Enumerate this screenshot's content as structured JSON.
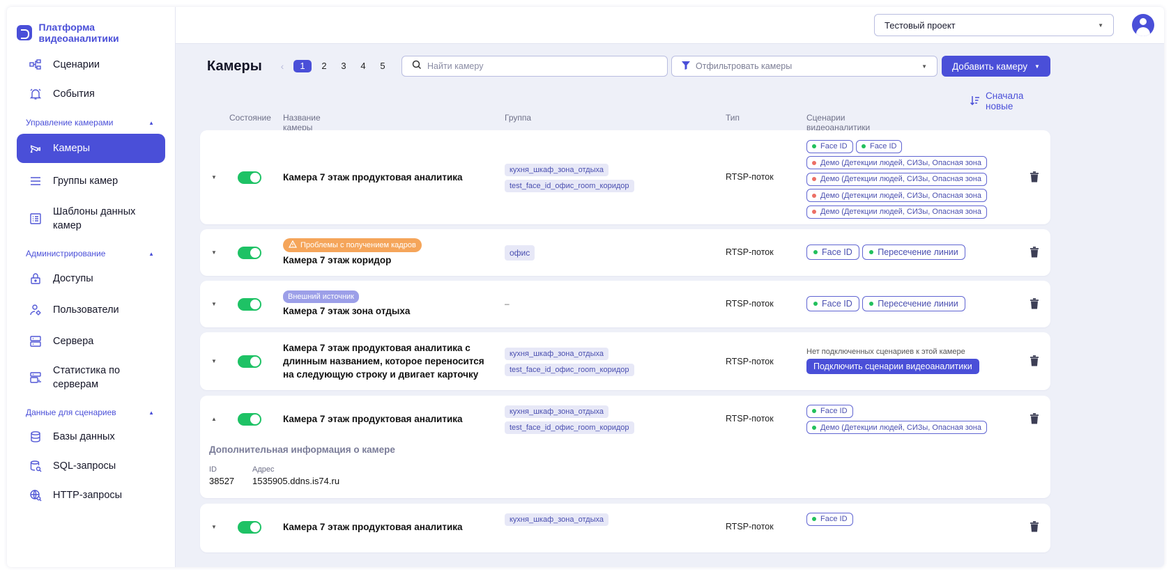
{
  "brand": {
    "title": "Платформа видеоаналитики"
  },
  "sidebar": {
    "items_top": [
      {
        "label": "Сценарии",
        "icon": "scenarios-icon"
      },
      {
        "label": "События",
        "icon": "bell-icon"
      }
    ],
    "section_cameras": "Управление камерами",
    "items_cameras": [
      {
        "label": "Камеры",
        "icon": "camera-icon",
        "active": true
      },
      {
        "label": "Группы камер",
        "icon": "list-icon"
      },
      {
        "label": "Шаблоны данных камер",
        "icon": "template-icon"
      }
    ],
    "section_admin": "Администрирование",
    "items_admin": [
      {
        "label": "Доступы",
        "icon": "lock-icon"
      },
      {
        "label": "Пользователи",
        "icon": "users-icon"
      },
      {
        "label": "Сервера",
        "icon": "server-icon"
      },
      {
        "label": "Статистика по серверам",
        "icon": "stats-icon"
      }
    ],
    "section_data": "Данные для сценариев",
    "items_data": [
      {
        "label": "Базы данных",
        "icon": "database-icon"
      },
      {
        "label": "SQL-запросы",
        "icon": "sql-icon"
      },
      {
        "label": "HTTP-запросы",
        "icon": "http-icon"
      }
    ]
  },
  "header": {
    "project": "Тестовый проект"
  },
  "toolbar": {
    "title": "Камеры",
    "pages": [
      "1",
      "2",
      "3",
      "4",
      "5"
    ],
    "current_page": "1",
    "search_placeholder": "Найти камеру",
    "filter_placeholder": "Отфильтровать камеры",
    "add_button": "Добавить камеру",
    "sort": "Сначала новые"
  },
  "columns": {
    "state": "Состояние",
    "name": "Название камеры",
    "group": "Группа",
    "type": "Тип",
    "scenarios": "Сценарии видеоаналитики"
  },
  "cameras": [
    {
      "name": "Камера 7 этаж продуктовая аналитика",
      "groups": [
        "кухня_шкаф_зона_отдыха",
        "test_face_id_офис_room_коридор"
      ],
      "type": "RTSP-поток",
      "scenarios": [
        "Face ID",
        "Face ID",
        "Демо (Детекции людей, СИЗы, Опасная зона",
        "Демо (Детекции людей, СИЗы, Опасная зона",
        "Демо (Детекции людей, СИЗы, Опасная зона",
        "Демо (Детекции людей, СИЗы, Опасная зона"
      ]
    },
    {
      "badge": "Проблемы с получением кадров",
      "name": "Камера 7 этаж коридор",
      "groups": [
        "офис"
      ],
      "type": "RTSP-поток",
      "scenarios": [
        "Face ID",
        "Пересечение линии"
      ]
    },
    {
      "badge": "Внешний источник",
      "name": "Камера 7 этаж зона отдыха",
      "group_empty": "–",
      "type": "RTSP-поток",
      "scenarios": [
        "Face ID",
        "Пересечение линии"
      ]
    },
    {
      "name": "Камера 7 этаж продуктовая аналитика с длинным названием, которое переносится на следующую строку и двигает карточку",
      "groups": [
        "кухня_шкаф_зона_отдыха",
        "test_face_id_офис_room_коридор"
      ],
      "type": "RTSP-поток",
      "no_scenarios": "Нет подключенных сценариев к этой камере",
      "connect_button": "Подключить сценарии видеоаналитики"
    },
    {
      "name": "Камера 7 этаж продуктовая аналитика",
      "groups": [
        "кухня_шкаф_зона_отдыха",
        "test_face_id_офис_room_коридор"
      ],
      "type": "RTSP-поток",
      "scenarios": [
        "Face ID",
        "Демо (Детекции людей, СИЗы, Опасная зона"
      ],
      "details": {
        "title": "Дополнительная информация о камере",
        "id_label": "ID",
        "id": "38527",
        "address_label": "Адрес",
        "address": "1535905.ddns.is74.ru"
      }
    },
    {
      "name": "Камера 7 этаж продуктовая аналитика",
      "groups": [
        "кухня_шкаф_зона_отдыха"
      ],
      "type": "RTSP-поток",
      "scenarios": [
        "Face ID"
      ]
    }
  ],
  "colors": {
    "accent": "#4a4fd8",
    "toggle_on": "#1ec265",
    "warning": "#f5a55a",
    "external": "#9c9fe8"
  }
}
